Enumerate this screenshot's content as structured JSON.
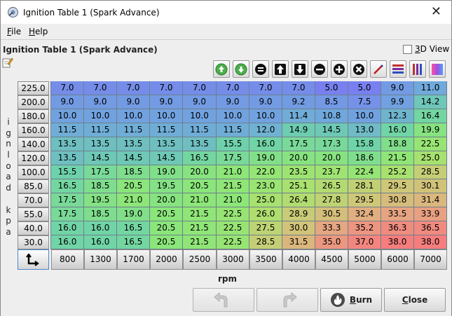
{
  "window": {
    "title": "Ignition Table 1 (Spark Advance)",
    "close_glyph": "✕"
  },
  "menu": [
    {
      "label": "File",
      "mnemonic": "F",
      "rest": "ile"
    },
    {
      "label": "Help",
      "mnemonic": "H",
      "rest": "elp"
    }
  ],
  "panel": {
    "title": "Ignition Table 1 (Spark Advance)",
    "view3d": {
      "checked": false,
      "label": "3D View",
      "mnemonic": "3",
      "rest": "D View"
    }
  },
  "toolbar": [
    {
      "name": "scroll-up-button",
      "icon": "arrow-up-circle-green"
    },
    {
      "name": "scroll-down-button",
      "icon": "arrow-down-circle-green"
    },
    {
      "name": "set-equal-button",
      "icon": "equals-circle"
    },
    {
      "name": "increment-button",
      "icon": "arrow-up-square"
    },
    {
      "name": "decrement-button",
      "icon": "arrow-down-square"
    },
    {
      "name": "subtract-button",
      "icon": "minus-circle"
    },
    {
      "name": "add-button",
      "icon": "plus-circle"
    },
    {
      "name": "multiply-button",
      "icon": "times-circle"
    },
    {
      "name": "interpolate-button",
      "icon": "pen-line"
    },
    {
      "name": "smooth-rows-button",
      "icon": "horizontal-bars"
    },
    {
      "name": "smooth-columns-button",
      "icon": "vertical-bars"
    },
    {
      "name": "color-gradient-button",
      "icon": "gradient"
    }
  ],
  "y_axis": {
    "label": "ignload kpa"
  },
  "x_axis": {
    "label": "rpm"
  },
  "table": {
    "rows": [
      "225.0",
      "200.0",
      "180.0",
      "160.0",
      "140.0",
      "120.0",
      "100.0",
      "85.0",
      "70.0",
      "55.0",
      "40.0",
      "30.0"
    ],
    "cols": [
      "800",
      "1300",
      "1700",
      "2000",
      "2500",
      "3000",
      "3500",
      "4000",
      "4500",
      "5000",
      "6000",
      "7000"
    ],
    "values": [
      [
        "7.0",
        "7.0",
        "7.0",
        "7.0",
        "7.0",
        "7.0",
        "7.0",
        "7.0",
        "5.0",
        "5.0",
        "9.0",
        "11.0"
      ],
      [
        "9.0",
        "9.0",
        "9.0",
        "9.0",
        "9.0",
        "9.0",
        "9.0",
        "9.2",
        "8.5",
        "7.5",
        "9.9",
        "14.2"
      ],
      [
        "10.0",
        "10.0",
        "10.0",
        "10.0",
        "10.0",
        "10.0",
        "10.0",
        "11.4",
        "10.8",
        "10.0",
        "12.3",
        "16.4"
      ],
      [
        "11.5",
        "11.5",
        "11.5",
        "11.5",
        "11.5",
        "11.5",
        "12.0",
        "14.9",
        "14.5",
        "13.0",
        "16.0",
        "19.9"
      ],
      [
        "13.5",
        "13.5",
        "13.5",
        "13.5",
        "13.5",
        "15.5",
        "16.0",
        "17.5",
        "17.3",
        "15.8",
        "18.8",
        "22.5"
      ],
      [
        "13.5",
        "14.5",
        "14.5",
        "14.5",
        "16.5",
        "17.5",
        "19.0",
        "20.0",
        "20.0",
        "18.6",
        "21.5",
        "25.0"
      ],
      [
        "15.5",
        "17.5",
        "18.5",
        "19.0",
        "20.0",
        "21.0",
        "22.0",
        "23.5",
        "23.7",
        "22.4",
        "25.2",
        "28.5"
      ],
      [
        "16.5",
        "18.5",
        "20.5",
        "19.5",
        "20.5",
        "21.5",
        "23.0",
        "25.1",
        "26.5",
        "28.1",
        "29.5",
        "30.1"
      ],
      [
        "17.5",
        "19.5",
        "21.0",
        "20.0",
        "21.0",
        "21.0",
        "25.0",
        "26.4",
        "27.8",
        "29.5",
        "30.8",
        "31.4"
      ],
      [
        "17.5",
        "18.5",
        "19.0",
        "20.5",
        "21.5",
        "22.5",
        "26.0",
        "28.9",
        "30.5",
        "32.4",
        "33.5",
        "33.9"
      ],
      [
        "16.0",
        "16.0",
        "16.5",
        "20.5",
        "21.5",
        "22.5",
        "27.5",
        "30.0",
        "33.3",
        "35.2",
        "36.3",
        "36.5"
      ],
      [
        "16.0",
        "16.0",
        "16.5",
        "20.5",
        "21.5",
        "22.5",
        "28.5",
        "31.5",
        "35.0",
        "37.0",
        "38.0",
        "38.0"
      ]
    ]
  },
  "buttons": {
    "undo": {
      "label": "",
      "enabled": false
    },
    "redo": {
      "label": "",
      "enabled": false
    },
    "burn": {
      "label": "Burn",
      "mnemonic": "B",
      "rest": "urn"
    },
    "close": {
      "label": "Close",
      "mnemonic": "C",
      "rest": "lose"
    }
  }
}
